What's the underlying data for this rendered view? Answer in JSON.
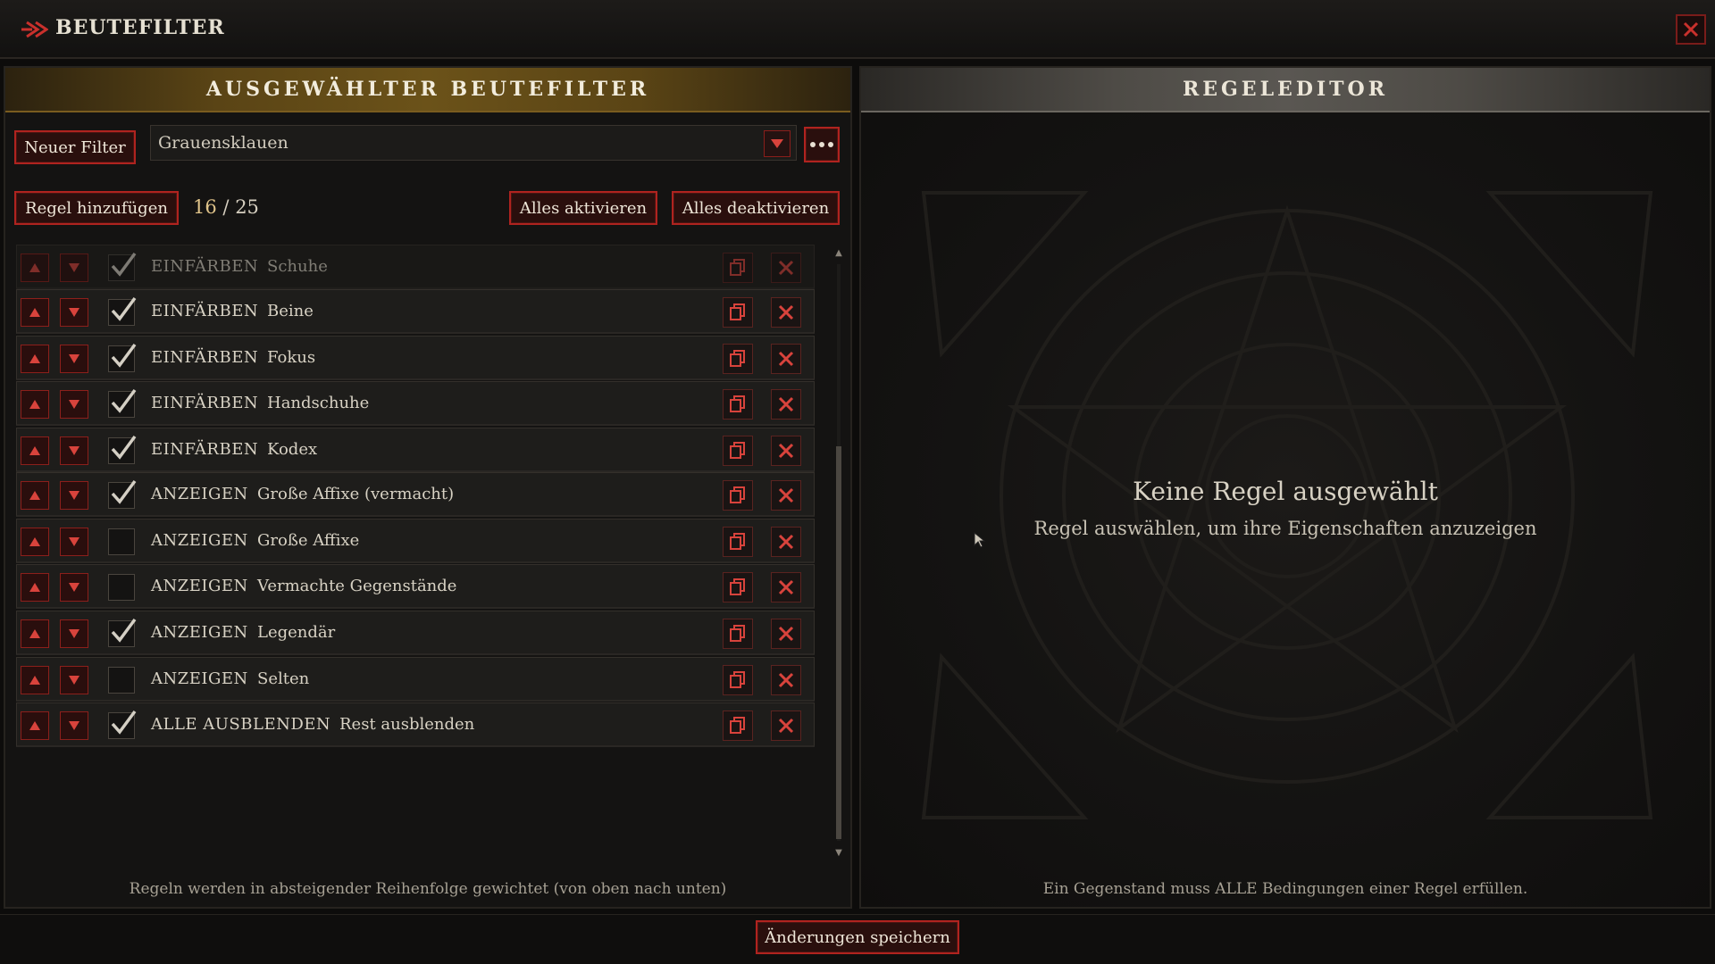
{
  "window": {
    "title": "BEUTEFILTER",
    "close_icon": "close-icon"
  },
  "left_panel": {
    "header": "AUSGEWÄHLTER BEUTEFILTER",
    "new_filter_label": "Neuer Filter",
    "filter_select": {
      "value": "Grauensklauen"
    },
    "add_rule_label": "Regel hinzufügen",
    "counter": {
      "current": "16",
      "separator": "/",
      "max": "25"
    },
    "activate_all_label": "Alles aktivieren",
    "deactivate_all_label": "Alles deaktivieren",
    "rules": [
      {
        "action": "EINFÄRBEN",
        "name": "Schuhe",
        "checked": true,
        "faded": true
      },
      {
        "action": "EINFÄRBEN",
        "name": "Beine",
        "checked": true
      },
      {
        "action": "EINFÄRBEN",
        "name": "Fokus",
        "checked": true
      },
      {
        "action": "EINFÄRBEN",
        "name": "Handschuhe",
        "checked": true
      },
      {
        "action": "EINFÄRBEN",
        "name": "Kodex",
        "checked": true
      },
      {
        "action": "ANZEIGEN",
        "name": "Große Affixe (vermacht)",
        "checked": true
      },
      {
        "action": "ANZEIGEN",
        "name": "Große Affixe",
        "checked": false
      },
      {
        "action": "ANZEIGEN",
        "name": "Vermachte Gegenstände",
        "checked": false
      },
      {
        "action": "ANZEIGEN",
        "name": "Legendär",
        "checked": true
      },
      {
        "action": "ANZEIGEN",
        "name": "Selten",
        "checked": false
      },
      {
        "action": "ALLE AUSBLENDEN",
        "name": "Rest ausblenden",
        "checked": true
      }
    ],
    "footnote": "Regeln werden in absteigender Reihenfolge gewichtet (von oben nach unten)"
  },
  "right_panel": {
    "header": "REGELEDITOR",
    "empty_title": "Keine Regel ausgewählt",
    "empty_subtitle": "Regel auswählen, um ihre Eigenschaften anzuzeigen",
    "footnote": "Ein Gegenstand muss ALLE Bedingungen einer Regel erfüllen."
  },
  "save_label": "Änderungen speichern",
  "colors": {
    "accent_red": "#b0231f",
    "gold": "#6b5219",
    "text": "#d8d2c4"
  }
}
